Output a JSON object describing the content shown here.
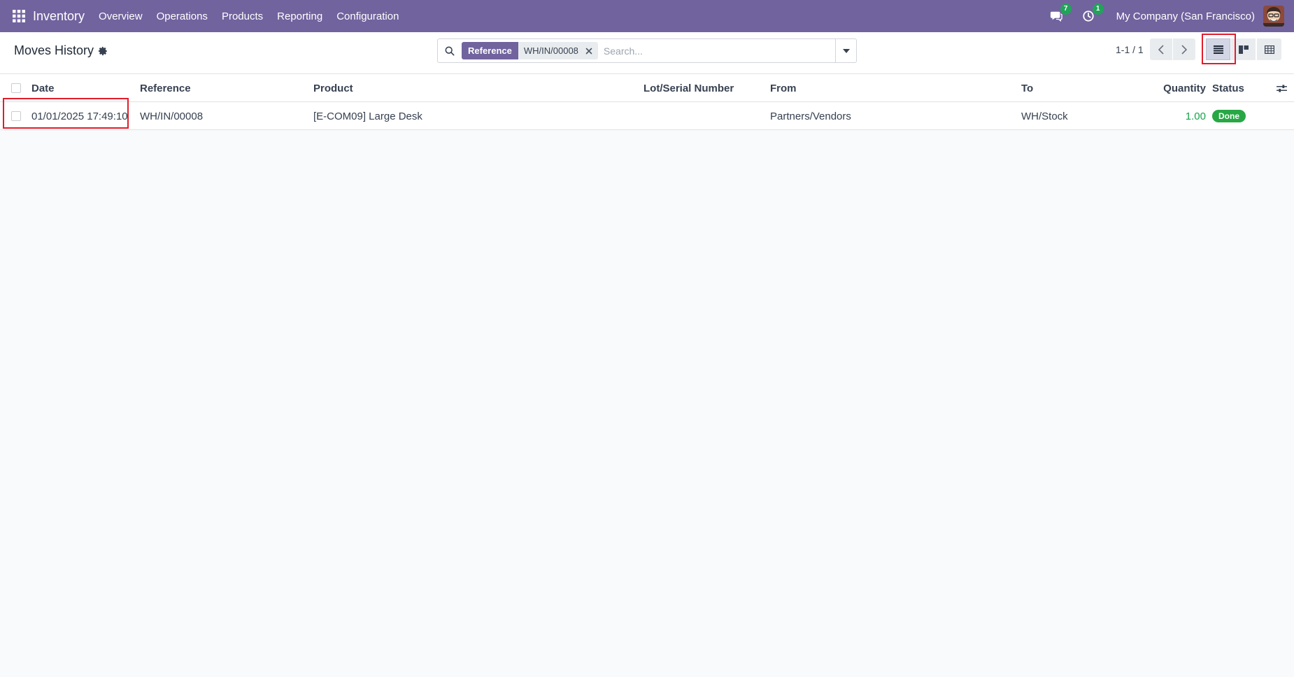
{
  "navbar": {
    "apps_icon": "grid-icon",
    "brand": "Inventory",
    "menu": [
      {
        "label": "Overview"
      },
      {
        "label": "Operations"
      },
      {
        "label": "Products"
      },
      {
        "label": "Reporting"
      },
      {
        "label": "Configuration"
      }
    ],
    "messages_badge": "7",
    "activities_badge": "1",
    "company": "My Company (San Francisco)"
  },
  "control_panel": {
    "title": "Moves History",
    "search": {
      "facet_label": "Reference",
      "facet_value": "WH/IN/00008",
      "placeholder": "Search..."
    },
    "pager": "1-1 / 1"
  },
  "table": {
    "headers": {
      "date": "Date",
      "reference": "Reference",
      "product": "Product",
      "lot": "Lot/Serial Number",
      "from": "From",
      "to": "To",
      "quantity": "Quantity",
      "status": "Status"
    },
    "rows": [
      {
        "date": "01/01/2025 17:49:10",
        "reference": "WH/IN/00008",
        "product": "[E-COM09] Large Desk",
        "lot": "",
        "from": "Partners/Vendors",
        "to": "WH/Stock",
        "quantity": "1.00",
        "status": "Done"
      }
    ]
  },
  "colors": {
    "brand": "#71639e",
    "success": "#28a745",
    "highlight": "#e11d2b"
  }
}
